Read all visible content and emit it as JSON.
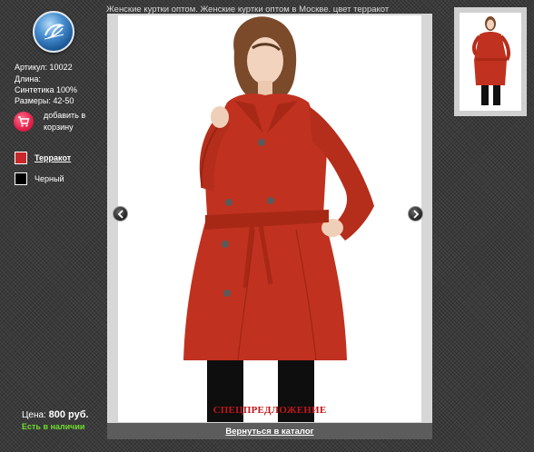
{
  "page": {
    "title": "Женские куртки оптом. Женские куртки оптом в Москве. цвет терракот"
  },
  "product": {
    "article": "Артикул: 10022",
    "length": "Длина:",
    "material": "Синтетика 100%",
    "sizes": "Размеры: 42-50"
  },
  "cart": {
    "label": "добавить в корзину",
    "icon": "cart-icon"
  },
  "colors": [
    {
      "label": "Терракот",
      "swatch": "#c8282a",
      "selected": true
    },
    {
      "label": "Черный",
      "swatch": "#000000",
      "selected": false
    }
  ],
  "price": {
    "label": "Цена:",
    "value": "800 руб."
  },
  "availability": "Есть в наличии",
  "promo": "СПЕЦПРЕДЛОЖЕНИЕ",
  "back_link": "Вернуться в каталог",
  "viewer": {
    "prev_icon": "chevron-left-icon",
    "next_icon": "chevron-right-icon"
  },
  "palette": {
    "coat": "#c0321f",
    "promo_text": "#c0141a",
    "availability_text": "#6fdc2e"
  }
}
